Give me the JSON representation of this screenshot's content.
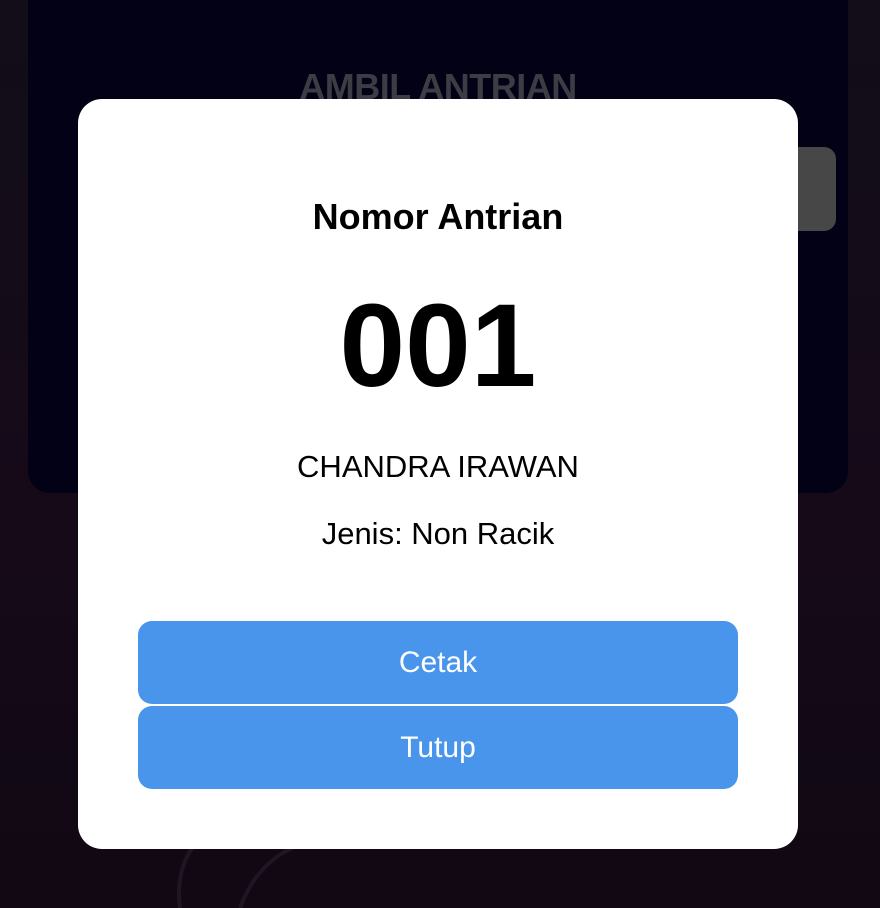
{
  "background": {
    "title": "AMBIL ANTRIAN",
    "colors": {
      "page": "#17101f",
      "card": "#03021a",
      "title": "#4a4a55",
      "button": "#575757"
    }
  },
  "modal": {
    "title": "Nomor Antrian",
    "queue_number": "001",
    "patient_name": "CHANDRA IRAWAN",
    "queue_type": "Jenis: Non Racik",
    "buttons": {
      "print_label": "Cetak",
      "close_label": "Tutup"
    },
    "colors": {
      "background": "#ffffff",
      "button": "#4a95ec",
      "button_text": "#ffffff"
    }
  }
}
